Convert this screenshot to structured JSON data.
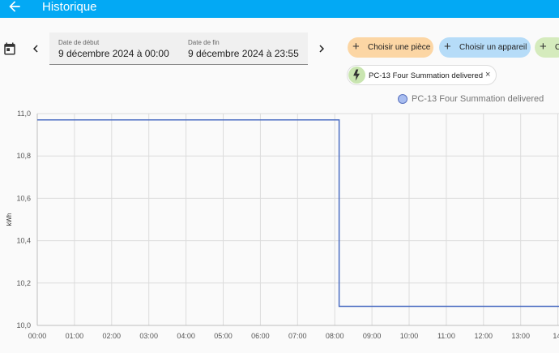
{
  "header": {
    "title": "Historique",
    "back_icon": "arrow-left-icon"
  },
  "date_range": {
    "start": {
      "label": "Date de début",
      "value": "9 décembre 2024 à 00:00"
    },
    "end": {
      "label": "Date de fin",
      "value": "9 décembre 2024 à 23:55"
    }
  },
  "filters": {
    "area": {
      "label": "Choisir une pièce",
      "color": "#fcd6a4"
    },
    "device": {
      "label": "Choisir un appareil",
      "color": "#b6dcf8"
    },
    "third": {
      "label": "C",
      "color": "#d5ebbd"
    }
  },
  "entity_chip": {
    "label": "PC-13 Four Summation delivered",
    "remove": "×",
    "icon": "flash-icon"
  },
  "colors": {
    "topbar": "#03a9f4",
    "series": "#4a6cc2"
  },
  "chart_data": {
    "type": "line",
    "xlabel": "",
    "ylabel": "kWh",
    "x_ticks": [
      "00:00",
      "01:00",
      "02:00",
      "03:00",
      "04:00",
      "05:00",
      "06:00",
      "07:00",
      "08:00",
      "09:00",
      "10:00",
      "11:00",
      "12:00",
      "13:00",
      "14:"
    ],
    "y_ticks": [
      "11,0",
      "10,8",
      "10,6",
      "10,4",
      "10,2",
      "10,0"
    ],
    "ylim": [
      10.0,
      11.0
    ],
    "xlim": [
      "00:00",
      "14:15"
    ],
    "grid": true,
    "legend_position": "top-right",
    "series": [
      {
        "name": "PC-13 Four Summation delivered",
        "step": true,
        "points": [
          {
            "x": "00:00",
            "y": 10.97
          },
          {
            "x": "08:07",
            "y": 10.97
          },
          {
            "x": "08:07",
            "y": 10.09
          },
          {
            "x": "14:15",
            "y": 10.09
          }
        ]
      }
    ]
  }
}
